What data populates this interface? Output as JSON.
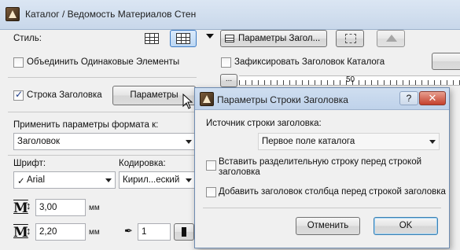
{
  "main_window": {
    "title": "Каталог / Ведомость Материалов Стен",
    "style_label": "Стиль:",
    "combine_label": "Объединить Одинаковые Элементы",
    "header_row_label": "Строка Заголовка",
    "params_button": "Параметры",
    "apply_format_label": "Применить параметры формата к:",
    "apply_format_value": "Заголовок",
    "font_label": "Шрифт:",
    "font_value": "Arial",
    "encoding_label": "Кодировка:",
    "encoding_value": "Кирил...еский",
    "height_value": "3,00",
    "height_unit": "мм",
    "width_value": "2,20",
    "width_unit": "мм",
    "pen_value": "1",
    "header_params_button": "Параметры Загол...",
    "lock_header_label": "Зафиксировать Заголовок Каталога",
    "ruler_button": "...",
    "ruler_tick_label": "50"
  },
  "dialog": {
    "title": "Параметры Строки Заголовка",
    "help_label": "?",
    "close_label": "✕",
    "source_label": "Источник строки заголовка:",
    "source_value": "Первое поле каталога",
    "separator_label_1": "Вставить разделительную строку перед строкой",
    "separator_label_2": "заголовка",
    "add_column_header_label": "Добавить заголовок столбца перед строкой заголовка",
    "cancel_button": "Отменить",
    "ok_button": "OK"
  }
}
